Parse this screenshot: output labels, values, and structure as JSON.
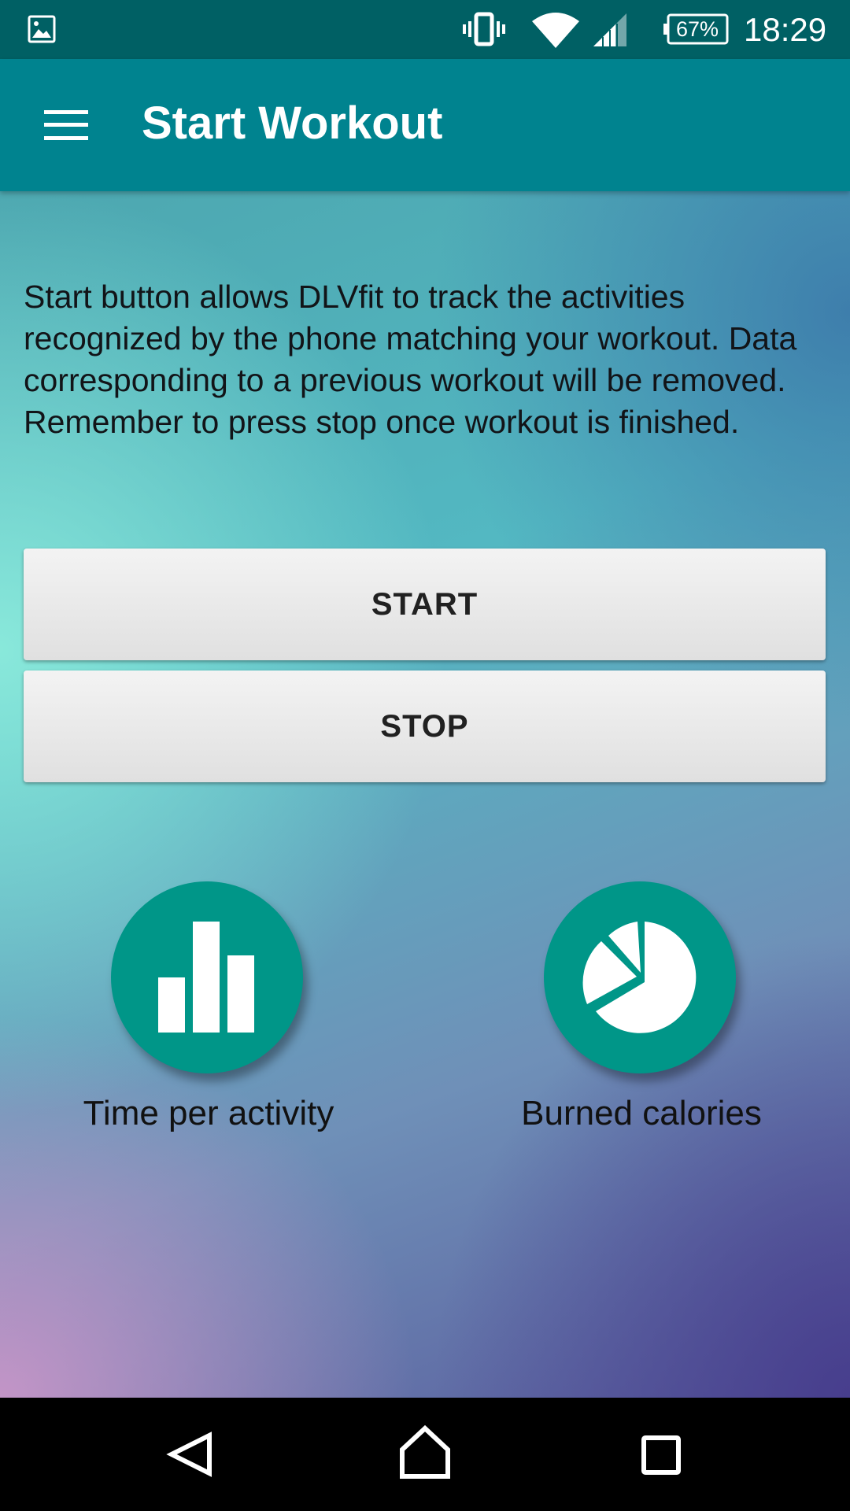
{
  "status_bar": {
    "notification_icon": "gallery-icon",
    "icons": [
      "vibrate-icon",
      "wifi-icon",
      "signal-icon",
      "battery-icon"
    ],
    "battery": "67%",
    "time": "18:29"
  },
  "app_bar": {
    "menu_icon": "menu-icon",
    "title": "Start Workout"
  },
  "main": {
    "description": "Start button allows DLVfit to track the activities recognized by the phone matching your workout. Data corresponding to a previous workout will be removed. Remember to press stop once workout is finished.",
    "start_label": "START",
    "stop_label": "STOP",
    "shortcuts": [
      {
        "icon": "bar-chart-icon",
        "label": "Time per activity"
      },
      {
        "icon": "pie-chart-icon",
        "label": "Burned calories"
      }
    ]
  },
  "nav_bar": {
    "icons": [
      "back-icon",
      "home-icon",
      "recents-icon"
    ]
  },
  "colors": {
    "status_bar": "#006064",
    "app_bar": "#00838f",
    "fab": "#009688",
    "button": "#e6e6e6"
  }
}
